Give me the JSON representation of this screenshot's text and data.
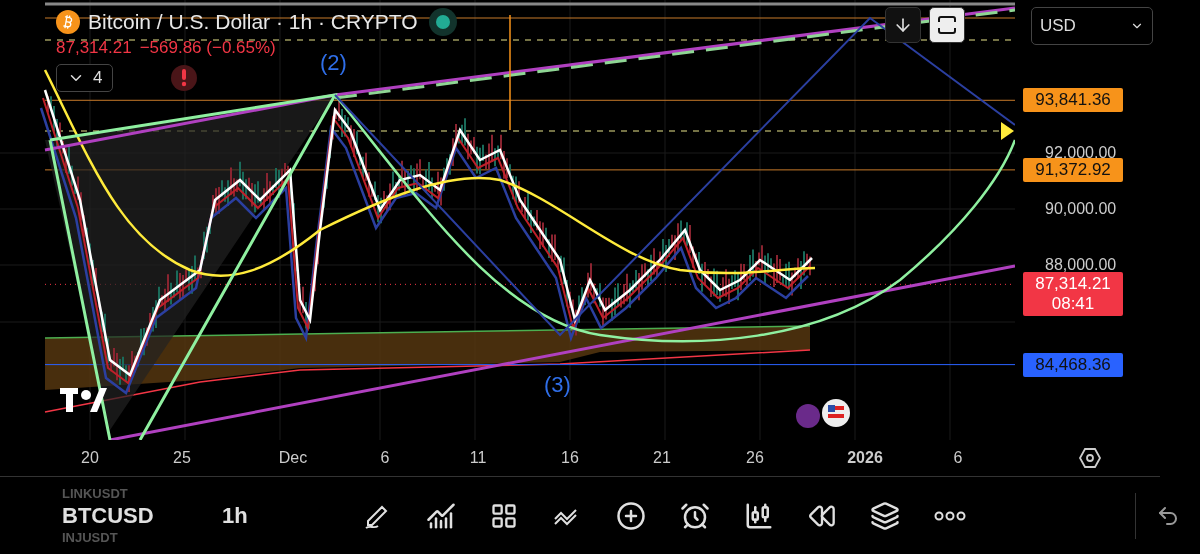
{
  "legend": {
    "title": "Bitcoin / U.S. Dollar · 1h · CRYPTO",
    "market_open": true,
    "price": "87,314.21",
    "change": "−569.86 (−0.65%)",
    "indicators_count": "4"
  },
  "top_controls": {
    "currency": "USD"
  },
  "wave_labels": [
    "(2)",
    "(3)"
  ],
  "price_axis": {
    "ticks": [
      "92,000.00",
      "90,000.00",
      "88,000.00"
    ],
    "tags": [
      {
        "kind": "level",
        "text": "93,841.36",
        "color": "#f7931a"
      },
      {
        "kind": "level",
        "text": "91,372.92",
        "color": "#f7931a"
      },
      {
        "kind": "current",
        "text": "87,314.21",
        "countdown": "08:41",
        "color": "#f23645"
      },
      {
        "kind": "level",
        "text": "84,468.36",
        "color": "#2962ff"
      }
    ]
  },
  "time_axis": [
    {
      "label": "20",
      "major": false
    },
    {
      "label": "25",
      "major": false
    },
    {
      "label": "Dec",
      "major": false
    },
    {
      "label": "6",
      "major": false
    },
    {
      "label": "11",
      "major": false
    },
    {
      "label": "16",
      "major": false
    },
    {
      "label": "21",
      "major": false
    },
    {
      "label": "26",
      "major": false
    },
    {
      "label": "2026",
      "major": true
    },
    {
      "label": "6",
      "major": false
    }
  ],
  "toolbar": {
    "symbols": [
      {
        "text": "LINKUSDT",
        "selected": false
      },
      {
        "text": "BTCUSD",
        "selected": true
      },
      {
        "text": "INJUSDT",
        "selected": false
      }
    ],
    "interval": "1h"
  }
}
